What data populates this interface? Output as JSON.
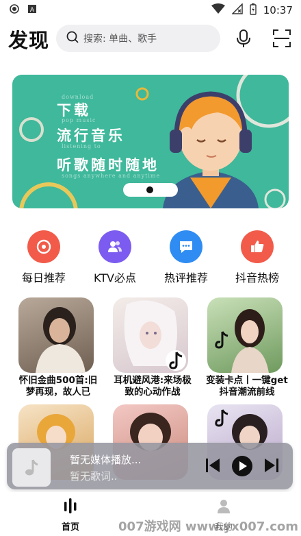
{
  "status": {
    "time": "10:37"
  },
  "header": {
    "title": "发现",
    "search_placeholder": "搜索: 单曲、歌手"
  },
  "banner": {
    "line1": "下载",
    "line2": "流行音乐",
    "line3": "听歌随时随地",
    "small1": "download",
    "small2": "pop music",
    "small3": "listening to",
    "small4": "songs anywhere and anytime"
  },
  "categories": [
    {
      "label": "每日推荐",
      "color": "#f25b4a",
      "icon": "disc-icon"
    },
    {
      "label": "KTV必点",
      "color": "#7c5cf0",
      "icon": "users-icon"
    },
    {
      "label": "热评推荐",
      "color": "#2f8cf3",
      "icon": "chat-icon"
    },
    {
      "label": "抖音热榜",
      "color": "#f25b4a",
      "icon": "thumbs-up-icon"
    }
  ],
  "playlists": [
    {
      "title": "怀旧金曲500首:旧梦再现，故人已"
    },
    {
      "title": "耳机避风港:来场极致的心动作战"
    },
    {
      "title": "变装卡点丨一键get抖音潮流前线"
    }
  ],
  "player": {
    "title": "暂无媒体播放...",
    "subtitle": "暂无歌词.."
  },
  "nav": {
    "home": "首页",
    "me": "我的"
  },
  "watermark": "007游戏网 www.yx007.com"
}
